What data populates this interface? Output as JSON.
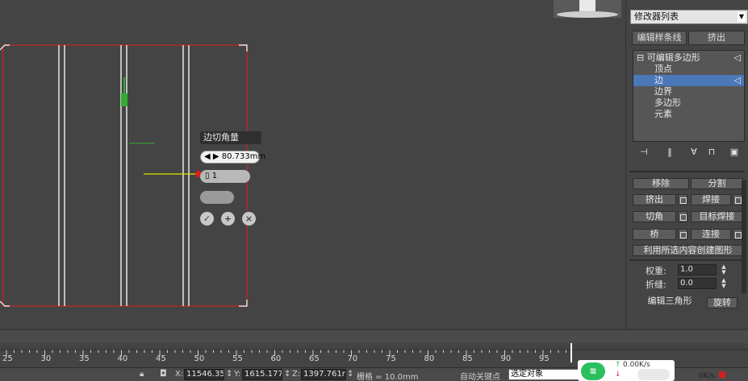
{
  "viewport": {
    "caddy": {
      "title": "边切角量",
      "amount": "80.733mm",
      "segments": "1"
    }
  },
  "panel": {
    "modifier_list": "修改器列表",
    "subtabs": [
      "编辑样条线",
      "挤出"
    ],
    "stack": [
      {
        "label": "可编辑多边形",
        "selected": false
      },
      {
        "label": "顶点",
        "selected": false
      },
      {
        "label": "边",
        "selected": true
      },
      {
        "label": "边界",
        "selected": false
      },
      {
        "label": "多边形",
        "selected": false
      },
      {
        "label": "元素",
        "selected": false
      }
    ],
    "buttons": {
      "remove": "移除",
      "split": "分割",
      "extrude": "挤出",
      "weld": "焊接",
      "chamfer": "切角",
      "target_weld": "目标焊接",
      "bridge": "桥",
      "connect": "连接",
      "create_shape": "利用所选内容创建图形",
      "edit_tri": "编辑三角形",
      "turn": "旋转"
    },
    "weight_label": "权重:",
    "weight_value": "1.0",
    "crease_label": "折缝:",
    "crease_value": "0.0"
  },
  "ruler": {
    "ticks": [
      "25",
      "30",
      "35",
      "40",
      "45",
      "50",
      "55",
      "60",
      "65",
      "70",
      "75",
      "80",
      "85",
      "90",
      "95"
    ]
  },
  "statusbar": {
    "x_label": "X:",
    "x_value": "11546.35m",
    "y_label": "Y:",
    "y_value": "1615.177m",
    "z_label": "Z:",
    "z_value": "1397.761m",
    "grid": "栅格 = 10.0mm",
    "auto_key": "自动关键点",
    "selection": "选定对象"
  },
  "network": {
    "speed": "0.00K/s",
    "right_text": "0K/s"
  },
  "colors": {
    "background": "#444444",
    "frame_red": "#b02a2a",
    "selection_blue": "#4a78b8",
    "gizmo_green": "#2fae2f",
    "gizmo_yellow": "#e4e400"
  }
}
